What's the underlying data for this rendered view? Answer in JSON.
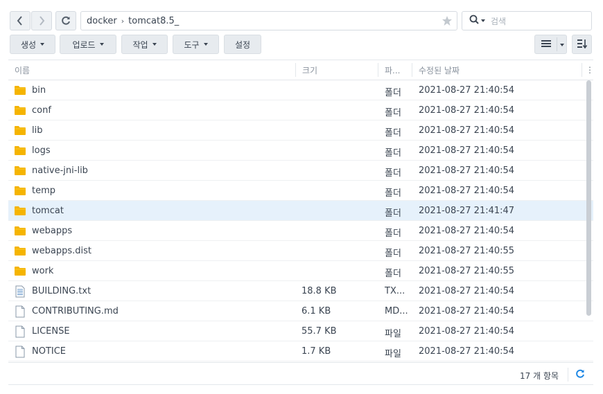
{
  "nav": {
    "path_root": "docker",
    "path_current": "tomcat8.5_",
    "search_placeholder": "검색"
  },
  "toolbar": {
    "create": "생성",
    "upload": "업로드",
    "action": "작업",
    "tools": "도구",
    "settings": "설정"
  },
  "columns": {
    "name": "이름",
    "size": "크기",
    "type": "파...",
    "modified": "수정된 날짜"
  },
  "files": [
    {
      "name": "bin",
      "size": "",
      "type": "폴더",
      "modified": "2021-08-27 21:40:54",
      "icon": "folder-icon"
    },
    {
      "name": "conf",
      "size": "",
      "type": "폴더",
      "modified": "2021-08-27 21:40:54",
      "icon": "folder-icon"
    },
    {
      "name": "lib",
      "size": "",
      "type": "폴더",
      "modified": "2021-08-27 21:40:54",
      "icon": "folder-icon"
    },
    {
      "name": "logs",
      "size": "",
      "type": "폴더",
      "modified": "2021-08-27 21:40:54",
      "icon": "folder-icon"
    },
    {
      "name": "native-jni-lib",
      "size": "",
      "type": "폴더",
      "modified": "2021-08-27 21:40:54",
      "icon": "folder-icon"
    },
    {
      "name": "temp",
      "size": "",
      "type": "폴더",
      "modified": "2021-08-27 21:40:54",
      "icon": "folder-icon"
    },
    {
      "name": "tomcat",
      "size": "",
      "type": "폴더",
      "modified": "2021-08-27 21:41:47",
      "icon": "folder-icon"
    },
    {
      "name": "webapps",
      "size": "",
      "type": "폴더",
      "modified": "2021-08-27 21:40:54",
      "icon": "folder-icon"
    },
    {
      "name": "webapps.dist",
      "size": "",
      "type": "폴더",
      "modified": "2021-08-27 21:40:55",
      "icon": "folder-icon"
    },
    {
      "name": "work",
      "size": "",
      "type": "폴더",
      "modified": "2021-08-27 21:40:55",
      "icon": "folder-icon"
    },
    {
      "name": "BUILDING.txt",
      "size": "18.8 KB",
      "type": "TX...",
      "modified": "2021-08-27 21:40:54",
      "icon": "text-file-icon"
    },
    {
      "name": "CONTRIBUTING.md",
      "size": "6.1 KB",
      "type": "MD...",
      "modified": "2021-08-27 21:40:54",
      "icon": "file-icon"
    },
    {
      "name": "LICENSE",
      "size": "55.7 KB",
      "type": "파일",
      "modified": "2021-08-27 21:40:54",
      "icon": "file-icon"
    },
    {
      "name": "NOTICE",
      "size": "1.7 KB",
      "type": "파일",
      "modified": "2021-08-27 21:40:54",
      "icon": "file-icon"
    }
  ],
  "selected_row": "tomcat",
  "footer": {
    "item_count": "17 개 항목"
  },
  "colors": {
    "folder": "#f5b400",
    "selected_row": "#e6f1fb",
    "accent": "#1e88e5"
  }
}
